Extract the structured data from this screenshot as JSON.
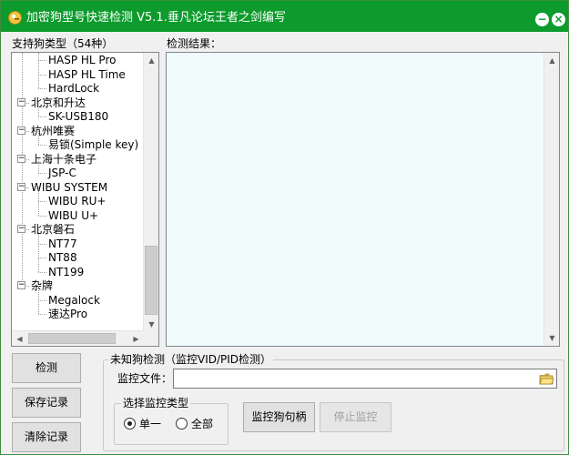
{
  "window": {
    "title": "加密狗型号快速检测 V5.1.垂凡论坛王者之剑编写",
    "minimize_glyph": "−",
    "close_glyph": "×"
  },
  "left_panel": {
    "label": "支持狗类型（54种）"
  },
  "tree": {
    "items": [
      {
        "text": "HASP HL Pro",
        "type": "child"
      },
      {
        "text": "HASP HL Time",
        "type": "child"
      },
      {
        "text": "HardLock",
        "type": "child"
      },
      {
        "text": "北京和升达",
        "type": "parent"
      },
      {
        "text": "SK-USB180",
        "type": "child"
      },
      {
        "text": "杭州唯赛",
        "type": "parent"
      },
      {
        "text": "易锁(Simple key)",
        "type": "child"
      },
      {
        "text": "上海十条电子",
        "type": "parent"
      },
      {
        "text": "JSP-C",
        "type": "child"
      },
      {
        "text": "WIBU SYSTEM",
        "type": "parent"
      },
      {
        "text": "WIBU RU+",
        "type": "child"
      },
      {
        "text": "WIBU U+",
        "type": "child"
      },
      {
        "text": "北京磐石",
        "type": "parent"
      },
      {
        "text": "NT77",
        "type": "child"
      },
      {
        "text": "NT88",
        "type": "child"
      },
      {
        "text": "NT199",
        "type": "child"
      },
      {
        "text": "杂牌",
        "type": "parent"
      },
      {
        "text": "Megalock",
        "type": "child"
      },
      {
        "text": "速达Pro",
        "type": "child"
      }
    ],
    "collapse_glyph": "−"
  },
  "result": {
    "label": "检测结果："
  },
  "buttons": {
    "detect": "检测",
    "save_log": "保存记录",
    "clear_log": "清除记录",
    "monitor_handle": "监控狗句柄",
    "stop_monitor": "停止监控"
  },
  "unknown_group": {
    "title": "未知狗检测（监控VID/PID检测）",
    "monitor_file_label": "监控文件：",
    "monitor_file_value": ""
  },
  "monitor_type_group": {
    "title": "选择监控类型",
    "options": [
      {
        "label": "单一",
        "selected": true
      },
      {
        "label": "全部",
        "selected": false
      }
    ]
  },
  "colors": {
    "titlebar": "#0c9b2c",
    "result_bg": "#f0fcfc"
  }
}
